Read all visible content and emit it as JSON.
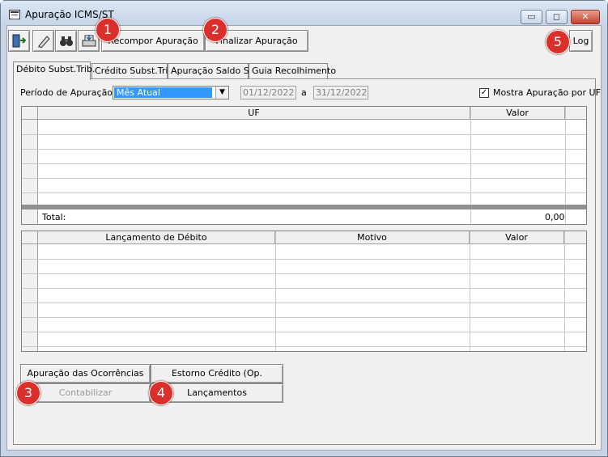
{
  "window": {
    "title": "Apuração ICMS/ST",
    "minimize": "▭",
    "maximize": "◻",
    "close": "✕"
  },
  "toolbar": {
    "icons": [
      "exit-icon",
      "edit-icon",
      "binoculars-icon",
      "print-icon"
    ],
    "recompor": "Recompor Apuração",
    "finalizar": "Finalizar Apuração",
    "log": "Log"
  },
  "badges": [
    "1",
    "2",
    "3",
    "4",
    "5"
  ],
  "tabs": [
    "Débito Subst.Trib.",
    "Crédito Subst.Trib.",
    "Apuração Saldo ST",
    "Guia Recolhimento"
  ],
  "period": {
    "label": "Período de  Apuração",
    "selected": "Mês Atual",
    "from": "01/12/2022",
    "sep": "a",
    "to": "31/12/2022",
    "checkbox_label": "Mostra Apuração por UF",
    "checked": true
  },
  "grid1": {
    "col_uf": "UF",
    "col_valor": "Valor",
    "total_label": "Total:",
    "total_value": "0,00"
  },
  "grid2": {
    "col_lanc": "Lançamento de Débito",
    "col_motivo": "Motivo",
    "col_valor": "Valor"
  },
  "buttons": {
    "ocorrencias": "Apuração das Ocorrências",
    "estorno": "Estorno Crédito (Op. Internas)",
    "contabilizar": "Contabilizar",
    "lancamentos": "Lançamentos"
  }
}
